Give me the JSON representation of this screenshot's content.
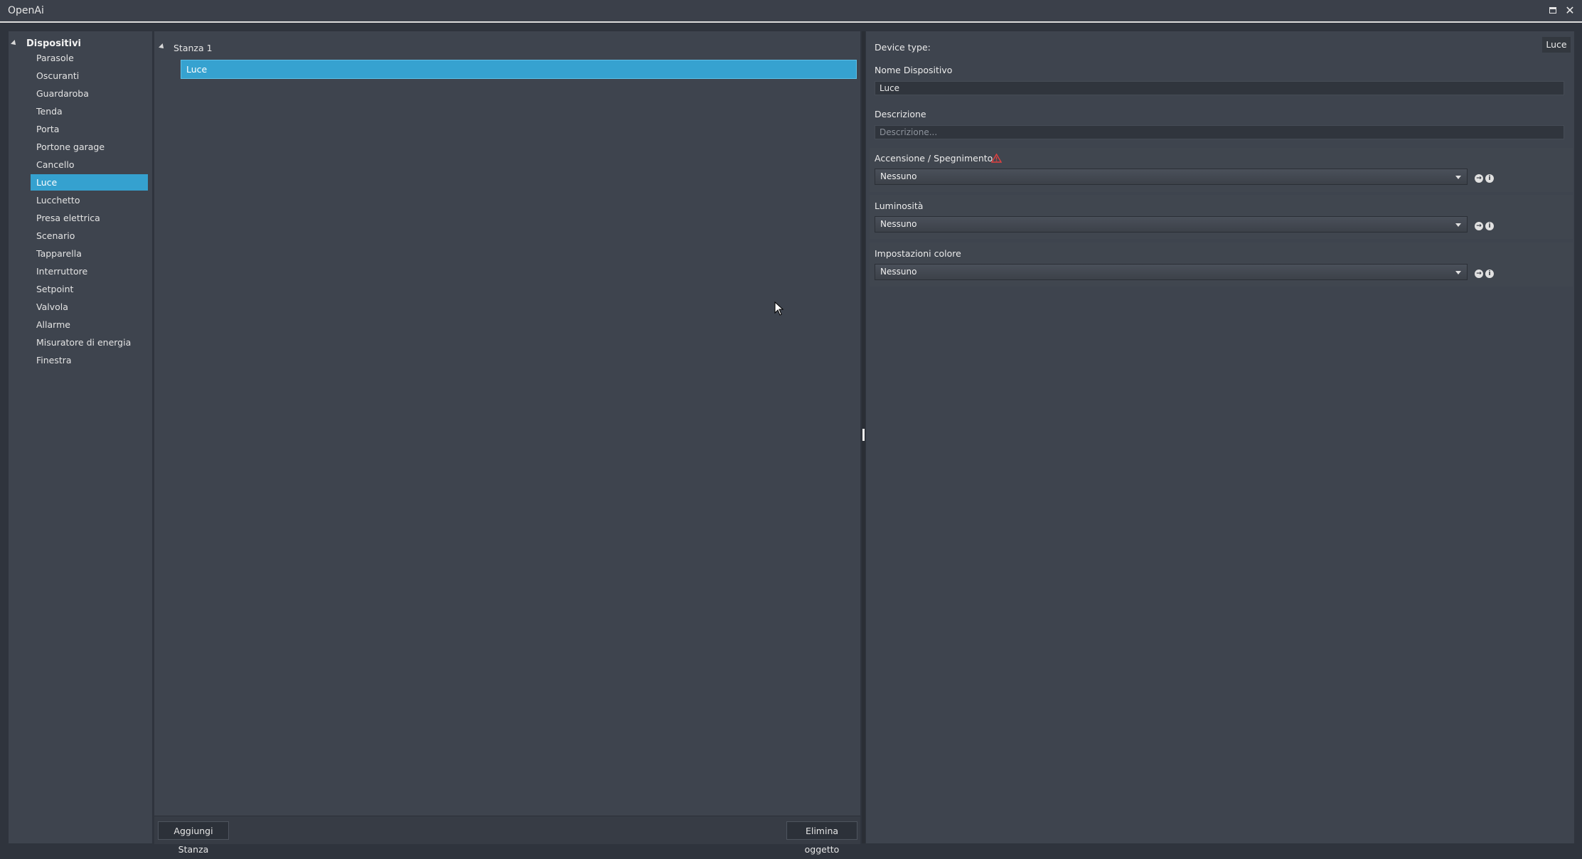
{
  "window": {
    "title": "OpenAi"
  },
  "sidebar": {
    "root_label": "Dispositivi",
    "items": [
      {
        "label": "Parasole"
      },
      {
        "label": "Oscuranti"
      },
      {
        "label": "Guardaroba"
      },
      {
        "label": "Tenda"
      },
      {
        "label": "Porta"
      },
      {
        "label": "Portone garage"
      },
      {
        "label": "Cancello"
      },
      {
        "label": "Luce",
        "selected": true
      },
      {
        "label": "Lucchetto"
      },
      {
        "label": "Presa elettrica"
      },
      {
        "label": "Scenario"
      },
      {
        "label": "Tapparella"
      },
      {
        "label": "Interruttore"
      },
      {
        "label": "Setpoint"
      },
      {
        "label": "Valvola"
      },
      {
        "label": "Allarme"
      },
      {
        "label": "Misuratore di energia"
      },
      {
        "label": "Finestra"
      }
    ]
  },
  "rooms": {
    "room_label": "Stanza 1",
    "device_label": "Luce"
  },
  "mid_footer": {
    "add_room": "Aggiungi Stanza",
    "delete_object": "Elimina oggetto"
  },
  "properties": {
    "device_type_label": "Device type:",
    "device_type_value": "Luce",
    "name_label": "Nome Dispositivo",
    "name_value": "Luce",
    "description_label": "Descrizione",
    "description_placeholder": "Descrizione...",
    "onoff_label": "Accensione / Spegnimento",
    "onoff_value": "Nessuno",
    "brightness_label": "Luminosità",
    "brightness_value": "Nessuno",
    "color_label": "Impostazioni colore",
    "color_value": "Nessuno"
  },
  "colors": {
    "accent": "#35a1cf",
    "warning": "#e04040",
    "background": "#3e444e"
  }
}
